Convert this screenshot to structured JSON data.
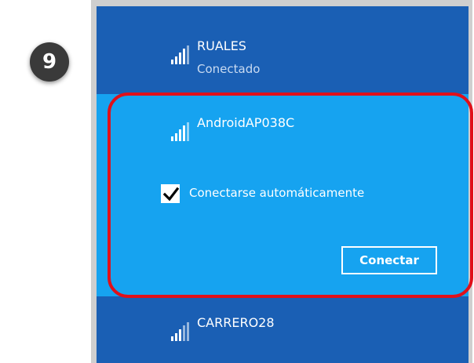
{
  "step_badge": {
    "number": "9"
  },
  "networks": [
    {
      "name": "RUALES",
      "status": "Conectado",
      "icon": "wifi-signal-icon"
    },
    {
      "name": "AndroidAP038C",
      "icon": "wifi-signal-icon",
      "auto_connect_label": "Conectarse automáticamente",
      "auto_connect_checked": true,
      "connect_label": "Conectar"
    },
    {
      "name": "CARRERO28",
      "icon": "wifi-signal-icon"
    }
  ],
  "colors": {
    "panel_bg": "#1254a8",
    "network_bg": "#1a5fb4",
    "selected_bg": "#16a3f0",
    "highlight": "#e0101a",
    "badge_bg": "#3a3a3a"
  }
}
